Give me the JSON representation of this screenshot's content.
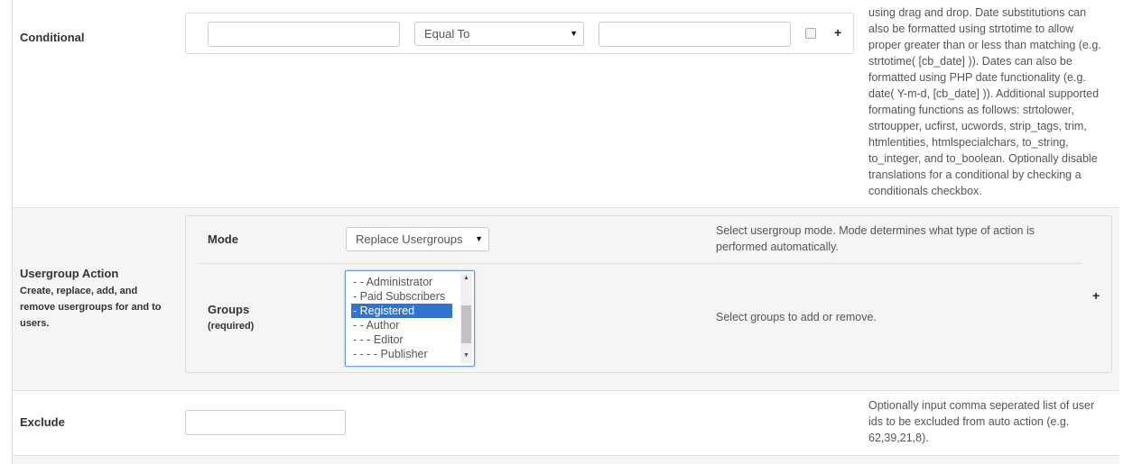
{
  "conditional": {
    "label": "Conditional",
    "operator_select": "Equal To",
    "help_lines": [
      "using drag and drop. Date substitutions can",
      "also be formatted using strtotime to allow",
      "proper greater than or less than matching (e.g.",
      "strtotime( [cb_date] )). Dates can also be",
      "formatted using PHP date functionality (e.g.",
      "date( Y-m-d, [cb_date] )). Additional supported",
      "formating functions as follows: strtolower,",
      "strtoupper, ucfirst, ucwords, strip_tags, trim,",
      "htmlentities, htmlspecialchars, to_string,",
      "to_integer, and to_boolean. Optionally disable",
      "translations for a conditional by checking a",
      "conditionals checkbox."
    ],
    "add_symbol": "+"
  },
  "usergroup_action": {
    "label": "Usergroup Action",
    "description_lines": [
      "Create, replace, add, and",
      "remove usergroups for and to",
      "users."
    ],
    "mode": {
      "label": "Mode",
      "select_value": "Replace Usergroups",
      "help_lines": [
        "Select usergroup mode. Mode determines what type of action is",
        "performed automatically."
      ]
    },
    "groups": {
      "label": "Groups",
      "required": "(required)",
      "options": [
        "- - Administrator",
        "- Paid Subscribers",
        "- Registered",
        "- - Author",
        "- - - Editor",
        "- - - - Publisher"
      ],
      "selected_index": 2,
      "help": "Select groups to add or remove."
    },
    "add_symbol": "+"
  },
  "exclude": {
    "label": "Exclude",
    "help_lines": [
      "Optionally input comma seperated list of user",
      "ids to be excluded from auto action (e.g.",
      "62,39,21,8)."
    ]
  },
  "icons": {
    "caret": "▼",
    "scroll_up": "▲",
    "scroll_down": "▼"
  }
}
